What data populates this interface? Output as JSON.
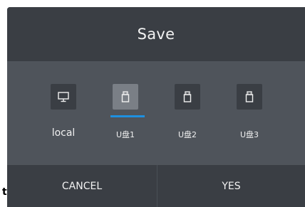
{
  "dialog": {
    "title": "Save",
    "devices": [
      {
        "label": "local",
        "icon": "monitor-icon",
        "selected": false
      },
      {
        "label": "U盘1",
        "icon": "usb-drive-icon",
        "selected": true
      },
      {
        "label": "U盘2",
        "icon": "usb-drive-icon",
        "selected": false
      },
      {
        "label": "U盘3",
        "icon": "usb-drive-icon",
        "selected": false
      }
    ],
    "cancel_label": "CANCEL",
    "yes_label": "YES"
  },
  "stray_text": "t",
  "colors": {
    "panel_dark": "#3a3e44",
    "panel_mid": "#4f545b",
    "tile_selected": "#7a7f86",
    "accent": "#1e90e0",
    "text": "#f2f2f2"
  }
}
